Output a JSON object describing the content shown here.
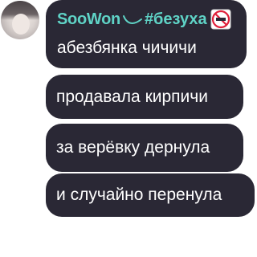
{
  "sender": {
    "username": "SooWon",
    "hashtag": "#безуха",
    "icons": [
      "wave-icon",
      "no-love-icon"
    ]
  },
  "messages": [
    {
      "text": "абезбянка чичичи"
    },
    {
      "text": "продавала кирпичи"
    },
    {
      "text": "за верёвку дернула"
    },
    {
      "text": "и случайно перенула"
    }
  ],
  "colors": {
    "bubble": "#2a2835",
    "accent": "#5fd3c6",
    "text": "#ffffff",
    "background": "#ffffff"
  }
}
